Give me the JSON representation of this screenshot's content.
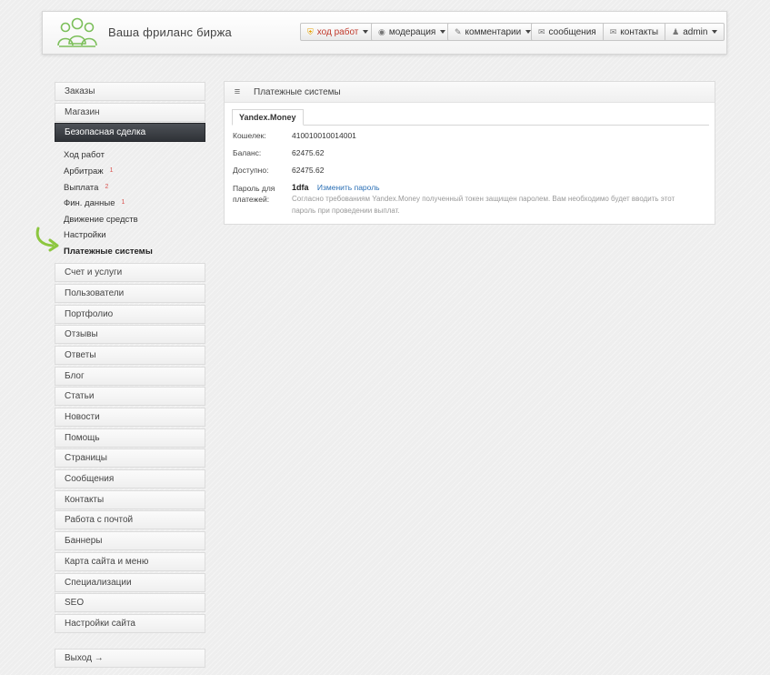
{
  "header": {
    "site_title": "Ваша фриланс биржа",
    "nav": [
      {
        "label": "ход работ",
        "icon": "shield-icon",
        "has_caret": true,
        "warn": true
      },
      {
        "label": "модерация",
        "icon": "eye-icon",
        "has_caret": true
      },
      {
        "label": "комментарии",
        "icon": "pencil-icon",
        "has_caret": true
      }
    ],
    "nav_joined": [
      {
        "label": "сообщения",
        "icon": "envelope-icon"
      },
      {
        "label": "контакты",
        "icon": "envelope-icon"
      },
      {
        "label": "admin",
        "icon": "user-icon",
        "has_caret": true
      }
    ]
  },
  "sidebar": {
    "top_items": [
      "Заказы",
      "Магазин"
    ],
    "active_item": "Безопасная сделка",
    "sub_items": [
      {
        "label": "Ход работ",
        "badge": ""
      },
      {
        "label": "Арбитраж",
        "badge": "1"
      },
      {
        "label": "Выплата",
        "badge": "2"
      },
      {
        "label": "Фин. данные",
        "badge": "1"
      },
      {
        "label": "Движение средств",
        "badge": ""
      },
      {
        "label": "Настройки",
        "badge": ""
      },
      {
        "label": "Платежные системы",
        "badge": "",
        "current": true
      }
    ],
    "items": [
      "Счет и услуги",
      "Пользователи",
      "Портфолио",
      "Отзывы",
      "Ответы",
      "Блог",
      "Статьи",
      "Новости",
      "Помощь",
      "Страницы",
      "Сообщения",
      "Контакты",
      "Работа с почтой",
      "Баннеры",
      "Карта сайта и меню",
      "Специализации",
      "SEO",
      "Настройки сайта"
    ],
    "logout": "Выход →"
  },
  "panel": {
    "title": "Платежные системы",
    "tab": "Yandex.Money",
    "wallet_label": "Кошелек:",
    "wallet_value": "410010010014001",
    "balance_label": "Баланс:",
    "balance_value": "62475.62",
    "available_label": "Доступно:",
    "available_value": "62475.62",
    "password_label": "Пароль для платежей:",
    "password_value": "1dfa",
    "change_password": "Изменить пароль",
    "hint": "Согласно требованиям Yandex.Money полученный токен защищен паролем. Вам необходимо будет вводить этот пароль при проведении выплат."
  },
  "colors": {
    "active_bg": "#3a3d42",
    "badge": "#d9534f",
    "link": "#2a6fb5",
    "arrow": "#8cc63f",
    "logo": "#7cbf5a"
  }
}
